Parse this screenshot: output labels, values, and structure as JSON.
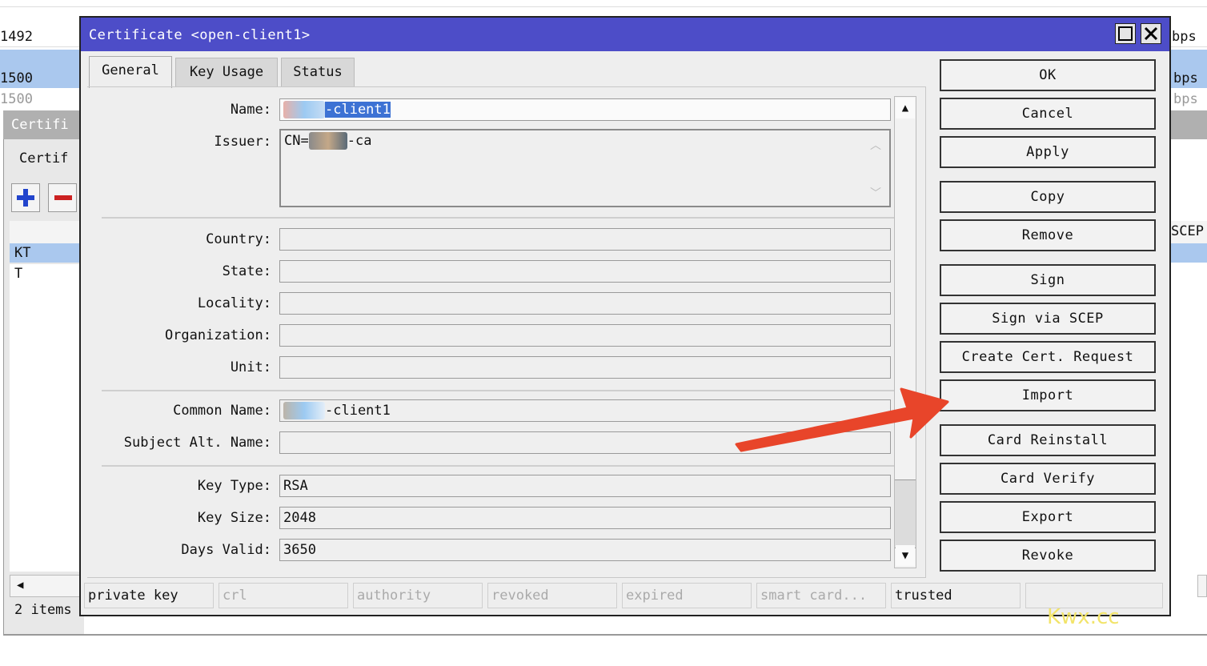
{
  "background": {
    "rows": [
      {
        "left": "1492",
        "right": "bps",
        "highlight": false
      },
      {
        "left": "1500",
        "right": "bps",
        "highlight": true
      },
      {
        "left": "1500",
        "right": "bps",
        "highlight": false
      }
    ],
    "window_title": "Certifi",
    "tab_label": "Certif",
    "list_items": [
      "KT",
      "T"
    ],
    "column_header_right": "SCEP",
    "status": "2 items"
  },
  "dialog": {
    "title": "Certificate <open-client1>",
    "tabs": [
      "General",
      "Key Usage",
      "Status"
    ],
    "active_tab": "General",
    "fields": {
      "name": {
        "label": "Name:",
        "value": "-client1"
      },
      "issuer": {
        "label": "Issuer:",
        "value_prefix": "CN=",
        "value_suffix": "-ca"
      },
      "country": {
        "label": "Country:",
        "value": ""
      },
      "state": {
        "label": "State:",
        "value": ""
      },
      "locality": {
        "label": "Locality:",
        "value": ""
      },
      "organization": {
        "label": "Organization:",
        "value": ""
      },
      "unit": {
        "label": "Unit:",
        "value": ""
      },
      "common_name": {
        "label": "Common Name:",
        "value": "-client1"
      },
      "subject_alt_name": {
        "label": "Subject Alt. Name:",
        "value": ""
      },
      "key_type": {
        "label": "Key Type:",
        "value": "RSA"
      },
      "key_size": {
        "label": "Key Size:",
        "value": "2048"
      },
      "days_valid": {
        "label": "Days Valid:",
        "value": "3650"
      }
    },
    "buttons": [
      "OK",
      "Cancel",
      "Apply",
      "Copy",
      "Remove",
      "Sign",
      "Sign via SCEP",
      "Create Cert. Request",
      "Import",
      "Card Reinstall",
      "Card Verify",
      "Export",
      "Revoke"
    ],
    "status_flags": [
      {
        "label": "private key",
        "active": true
      },
      {
        "label": "crl",
        "active": false
      },
      {
        "label": "authority",
        "active": false
      },
      {
        "label": "revoked",
        "active": false
      },
      {
        "label": "expired",
        "active": false
      },
      {
        "label": "smart card...",
        "active": false
      },
      {
        "label": "trusted",
        "active": true
      },
      {
        "label": "",
        "active": false
      }
    ]
  },
  "annotation": {
    "arrow_color": "#e8452a",
    "points_to": "Import"
  },
  "watermark": "Kwx.cc",
  "colors": {
    "titlebar": "#4d4dc8",
    "selection": "#3d72d4",
    "row_highlight": "#aac8ee"
  },
  "icons": [
    "maximize-icon",
    "close-icon",
    "plus-icon",
    "minus-icon",
    "scroll-up-icon",
    "scroll-down-icon",
    "scroll-left-icon"
  ]
}
